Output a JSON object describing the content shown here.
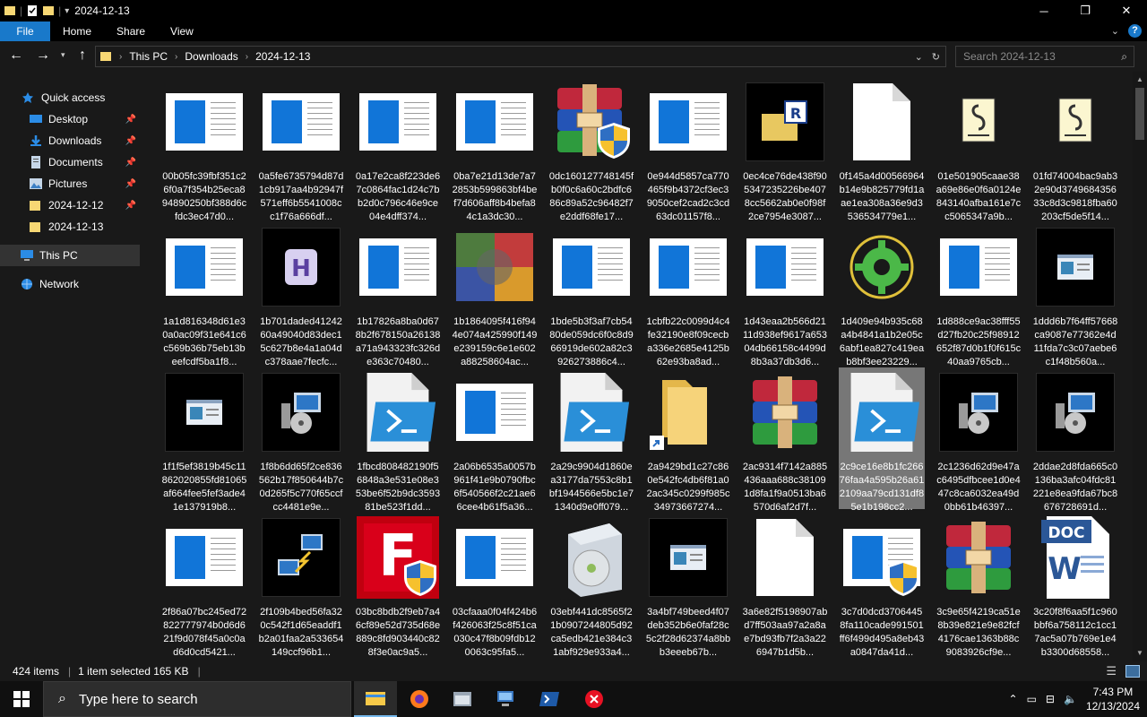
{
  "window": {
    "title": "2024-12-13",
    "controls": [
      "─",
      "❐",
      "✕"
    ]
  },
  "ribbon": {
    "tabs": [
      "File",
      "Home",
      "Share",
      "View"
    ]
  },
  "address": {
    "crumbs": [
      "This PC",
      "Downloads",
      "2024-12-13"
    ]
  },
  "search": {
    "placeholder": "Search 2024-12-13"
  },
  "sidebar": {
    "items": [
      {
        "label": "Quick access",
        "icon": "star-icon",
        "pinned": false
      },
      {
        "label": "Desktop",
        "icon": "desktop-icon",
        "pinned": true
      },
      {
        "label": "Downloads",
        "icon": "download-icon",
        "pinned": true
      },
      {
        "label": "Documents",
        "icon": "documents-icon",
        "pinned": true
      },
      {
        "label": "Pictures",
        "icon": "pictures-icon",
        "pinned": true
      },
      {
        "label": "2024-12-12",
        "icon": "folder-icon",
        "pinned": true
      },
      {
        "label": "2024-12-13",
        "icon": "folder-icon",
        "pinned": false
      },
      {
        "label": "This PC",
        "icon": "pc-icon",
        "pinned": false
      },
      {
        "label": "Network",
        "icon": "network-icon",
        "pinned": false
      }
    ]
  },
  "files": [
    {
      "name": "00b05fc39fbf351c26f0a7f354b25eca894890250bf388d6cfdc3ec47d0...",
      "icon": "doc"
    },
    {
      "name": "0a5fe6735794d87d1cb917aa4b92947f571eff6b5541008cc1f76a666df...",
      "icon": "doc"
    },
    {
      "name": "0a17e2ca8f223de67c0864fac1d24c7bb2d0c796c46e9ce04e4dff374...",
      "icon": "doc"
    },
    {
      "name": "0ba7e21d13de7a72853b599863bf4bef7d606aff8b4befa84c1a3dc30...",
      "icon": "doc"
    },
    {
      "name": "0dc160127748145fb0f0c6a60c2bdfc686c89a52c96482f7e2ddf68fe17...",
      "icon": "winrar-shield"
    },
    {
      "name": "0e944d5857ca770465f9b4372cf3ec39050cef2cad2c3cd63dc01157f8...",
      "icon": "doc"
    },
    {
      "name": "0ec4ce76de438f905347235226be4078cc5662ab0e0f98f2ce7954e3087...",
      "icon": "rfolder"
    },
    {
      "name": "0f145a4d00566964b14e9b825779fd1aae1ea308a36e9d3536534779e1...",
      "icon": "blank"
    },
    {
      "name": "01e501905caae38a69e86e0f6a0124e843140afba161e7cc5065347a9b...",
      "icon": "script"
    },
    {
      "name": "01fd74004bac9ab32e90d374968435633c8d3c9818fba60203cf5de5f14...",
      "icon": "script"
    },
    {
      "name": "1a1d816348d61e30a0ac09f31e641c6c569b36b75eb13beefcdf5ba1f8...",
      "icon": "doc"
    },
    {
      "name": "1b701daded4124260a49040d83dec15c627b8e4a1a04dc378aae7fecfc...",
      "icon": "h-app"
    },
    {
      "name": "1b17826a8ba0d678b2f678150a26138a71a943323fc326de363c70480...",
      "icon": "doc"
    },
    {
      "name": "1b1864095f416f944e074a425990f149e239159c6e1e602a88258604ac...",
      "icon": "colorbox"
    },
    {
      "name": "1bde5b3f3af7cb5480de059dc6f0c8d966919de602a82c3926273886c4...",
      "icon": "doc"
    },
    {
      "name": "1cbfb22c0099d4c4fe32190e8f09cecba336e2685e4125b62e93ba8ad...",
      "icon": "doc"
    },
    {
      "name": "1d43eaa2b566d2111d938ef9617a65304db66158c4499d8b3a37db3d6...",
      "icon": "doc"
    },
    {
      "name": "1d409e94b935c68a4b4841a1b2e05c6abf1ea827c419eab8bf3ee23229...",
      "icon": "gear"
    },
    {
      "name": "1d888ce9ac38fff55d27fb20c25f98912652f87d0b1f0f615c40aa9765cb...",
      "icon": "doc"
    },
    {
      "name": "1ddd6b7f64ff57668ca9087e77362e4d11fda7c3c07aebe6c1f48b560a...",
      "icon": "appwin"
    },
    {
      "name": "1f1f5ef3819b45c11862020855fd81065af664fee5fef3ade41e137919b8...",
      "icon": "appwin"
    },
    {
      "name": "1f8b6dd65f2ce836562b17f850644b7c0d265f5c770f65ccfcc4481e9e...",
      "icon": "installer"
    },
    {
      "name": "1fbcd808482190f56848a3e531e08e353be6f52b9dc359381be523f1dd...",
      "icon": "ps1"
    },
    {
      "name": "2a06b6535a0057b961f41e9b0790fbc6f540566f2c21ae66cee4b61f5a36...",
      "icon": "doc"
    },
    {
      "name": "2a29c9904d1860ea3177da7553c8b1bf1944566e5bc1e71340d9e0ff079...",
      "icon": "ps1"
    },
    {
      "name": "2a9429bd1c27c860e542fc4db6f81a02ac345c0299f985c34973667274...",
      "icon": "folder-shortcut"
    },
    {
      "name": "2ac9314f7142a885436aaa688c381091d8fa1f9a0513ba6570d6af2d7f...",
      "icon": "winrar"
    },
    {
      "name": "2c9ce16e8b1fc26676faa4a595b26a612109aa79cd131df85e1b198cc2...",
      "icon": "ps1",
      "selected": true
    },
    {
      "name": "2c1236d62d9e47ac6495dfbcee1d0e447c8ca6032ea49d0bb61b46397...",
      "icon": "installer"
    },
    {
      "name": "2ddae2d8fda665c0136ba3afc04fdc81221e8ea9fda67bc8676728691d...",
      "icon": "installer"
    },
    {
      "name": "2f86a07bc245ed72822777974b0d6d621f9d078f45a0c0ad6d0cd5421...",
      "icon": "doc"
    },
    {
      "name": "2f109b4bed56fa320c542f1d65eaddf1b2a01faa2a533654149ccf96b1...",
      "icon": "netpc"
    },
    {
      "name": "03bc8bdb2f9eb7a46cf89e52d735d68e889c8fd903440c828f3e0ac9a5...",
      "icon": "filezilla"
    },
    {
      "name": "03cfaaa0f04f424b6f426063f25c8f51ca030c47f8b09fdb120063c95fa5...",
      "icon": "doc"
    },
    {
      "name": "03ebf441dc8565f21b0907244805d92ca5edb421e384c31abf929e933a4...",
      "icon": "setupbox"
    },
    {
      "name": "3a4bf749beed4f07deb352b6e0faf28c5c2f28d62374a8bbb3eeeb67b...",
      "icon": "appwin"
    },
    {
      "name": "3a6e82f5198907abd7ff503aa97a2a8ae7bd93fb7f2a3a226947b1d5b...",
      "icon": "blank"
    },
    {
      "name": "3c7d0dcd37064458fa110cade991501ff6f499d495a8eb43a0847da41d...",
      "icon": "doc-shield"
    },
    {
      "name": "3c9e65f4219ca51e8b39e821e9e82fcf4176cae1363b88c9083926cf9e...",
      "icon": "winrar"
    },
    {
      "name": "3c20f8f6aa5f1c960bbf6a758112c1cc17ac5a07b769e1e4b3300d68558...",
      "icon": "word"
    }
  ],
  "status": {
    "count": "424 items",
    "selection": "1 item selected  165 KB"
  },
  "taskbar": {
    "search_placeholder": "Type here to search",
    "time": "7:43 PM",
    "date": "12/13/2024"
  },
  "colors": {
    "accent": "#1979ca",
    "doc_blue": "#1175d8"
  }
}
